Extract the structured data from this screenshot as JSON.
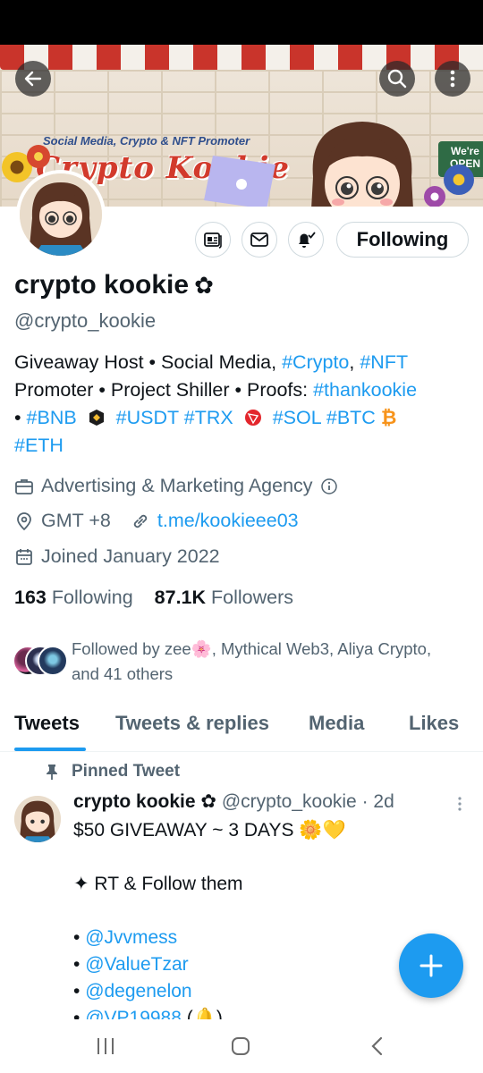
{
  "banner": {
    "tagline": "Social Media, Crypto & NFT Promoter",
    "title": "Crypto Kookie",
    "sign_text": "We're OPEN"
  },
  "header_buttons": {
    "back": "back-arrow-icon",
    "search": "search-icon",
    "more": "more-vertical-icon"
  },
  "actions": {
    "following_label": "Following"
  },
  "profile": {
    "name": "crypto kookie",
    "badge": "✿",
    "handle": "@crypto_kookie",
    "bio_line1_a": "Giveaway Host • Social Media, ",
    "bio_crypto": "#Crypto",
    "bio_comma": ", ",
    "bio_nft": "#NFT",
    "bio_line2_a": "Promoter • Project Shiller • Proofs: ",
    "bio_thankookie": "#thankookie",
    "bio_bullet": "• ",
    "bio_bnb": "#BNB",
    "bio_usdt": "#USDT",
    "bio_trx": "#TRX",
    "bio_sol": "#SOL",
    "bio_btc": "#BTC",
    "bio_eth": "#ETH",
    "category": "Advertising & Marketing Agency",
    "location": "GMT +8",
    "website": "t.me/kookieee03",
    "joined": "Joined January 2022",
    "following_count": "163",
    "following_label": "Following",
    "followers_count": "87.1K",
    "followers_label": "Followers",
    "followed_by": "Followed by zee🌸, Mythical Web3, Aliya Crypto, and 41 others"
  },
  "tabs": [
    {
      "label": "Tweets"
    },
    {
      "label": "Tweets & replies"
    },
    {
      "label": "Media"
    },
    {
      "label": "Likes"
    }
  ],
  "pinned_tweet": {
    "pinned_label": "Pinned Tweet",
    "author_name": "crypto kookie",
    "badge": "✿",
    "author_handle": "@crypto_kookie",
    "time": "· 2d",
    "line1": "$50 GIVEAWAY ~ 3 DAYS 🌼💛",
    "line2": "✦ RT & Follow them",
    "mentions": [
      "@Jvvmess",
      "@ValueTzar",
      "@degenelon",
      "@VP19988"
    ],
    "last_suffix": " (🔔)"
  },
  "colors": {
    "accent": "#1d9bf0",
    "text": "#0f1419",
    "muted": "#536471"
  }
}
